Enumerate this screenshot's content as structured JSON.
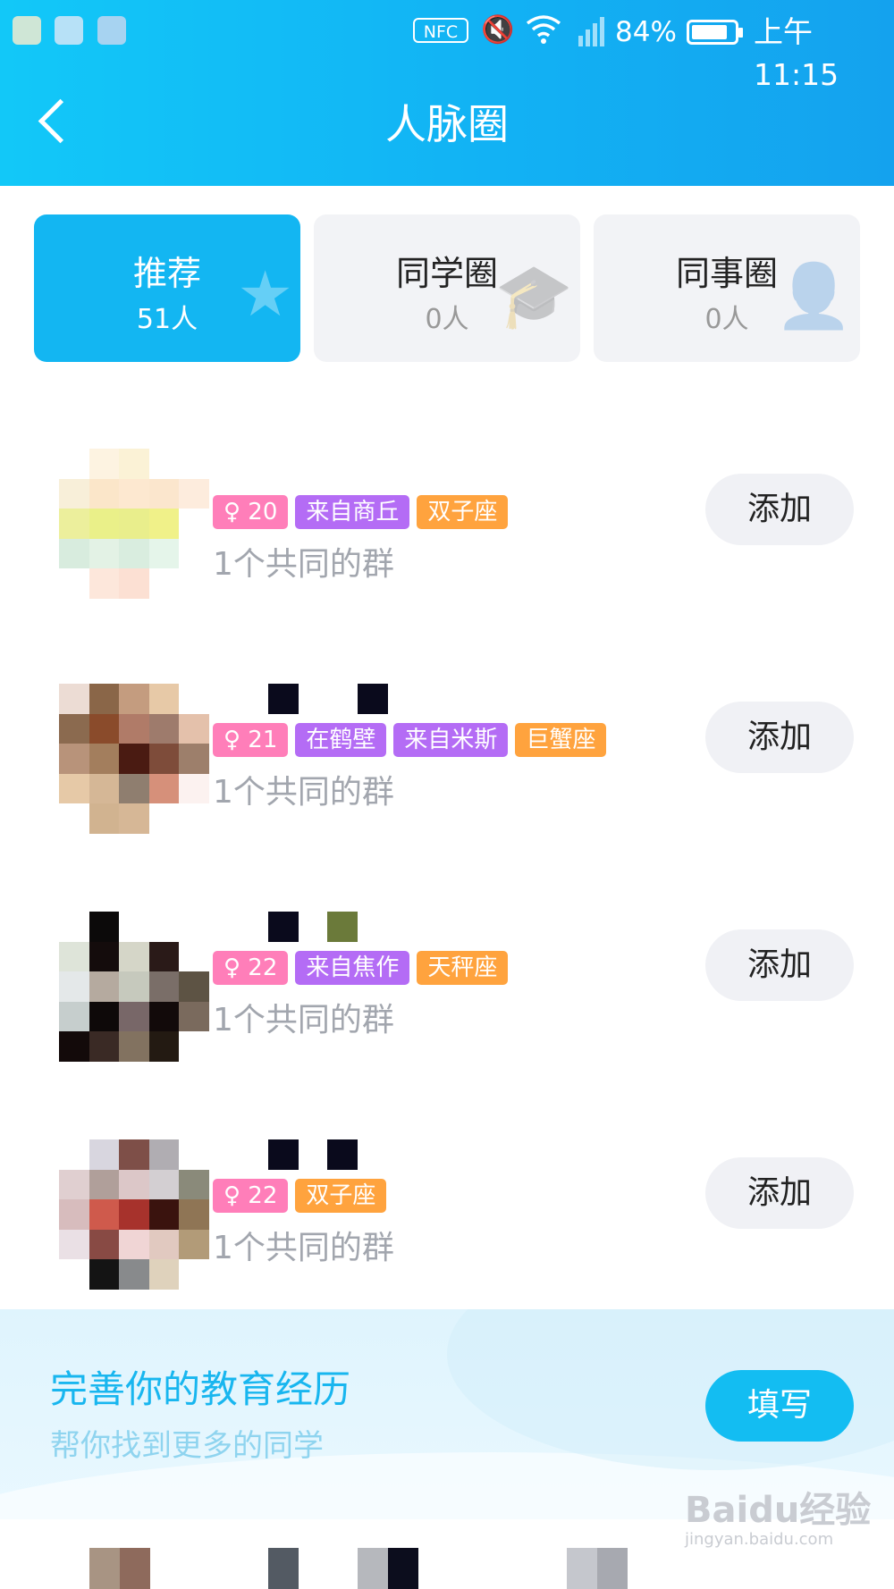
{
  "status_bar": {
    "nfc": "NFC",
    "battery_percent": "84%",
    "battery_level": 0.84,
    "time": "上午11:15",
    "icons": [
      "shield-app-icon",
      "wechat-icon",
      "gallery-icon",
      "mute-icon",
      "wifi-icon",
      "signal-icon"
    ]
  },
  "header": {
    "title": "人脉圈",
    "back_icon": "chevron-left-icon",
    "color": "#12b2f4"
  },
  "tabs": [
    {
      "label": "推荐",
      "count": "51人",
      "active": true,
      "icon": "star-card-icon"
    },
    {
      "label": "同学圈",
      "count": "0人",
      "active": false,
      "icon": "graduate-icon"
    },
    {
      "label": "同事圈",
      "count": "0人",
      "active": false,
      "icon": "worker-icon"
    }
  ],
  "people": [
    {
      "tags": [
        {
          "text": "♀ 20",
          "color": "pink"
        },
        {
          "text": "来自商丘",
          "color": "purple"
        },
        {
          "text": "双子座",
          "color": "orange"
        }
      ],
      "common_groups": "1个共同的群",
      "add_label": "添加"
    },
    {
      "tags": [
        {
          "text": "♀ 21",
          "color": "pink"
        },
        {
          "text": "在鹤壁",
          "color": "purple"
        },
        {
          "text": "来自米斯",
          "color": "purple"
        },
        {
          "text": "巨蟹座",
          "color": "orange"
        }
      ],
      "common_groups": "1个共同的群",
      "add_label": "添加"
    },
    {
      "tags": [
        {
          "text": "♀ 22",
          "color": "pink"
        },
        {
          "text": "来自焦作",
          "color": "purple"
        },
        {
          "text": "天秤座",
          "color": "orange"
        }
      ],
      "common_groups": "1个共同的群",
      "add_label": "添加"
    },
    {
      "tags": [
        {
          "text": "♀ 22",
          "color": "pink"
        },
        {
          "text": "双子座",
          "color": "orange"
        }
      ],
      "common_groups": "1个共同的群",
      "add_label": "添加"
    }
  ],
  "edu_banner": {
    "title": "完善你的教育经历",
    "subtitle": "帮你找到更多的同学",
    "button": "填写"
  },
  "watermark": {
    "logo": "Baidu经验",
    "url": "jingyan.baidu.com"
  },
  "colors": {
    "accent": "#13b6f2",
    "tag_pink": "#ff7eb9",
    "tag_purple": "#b46cf5",
    "tag_orange": "#ffa33e"
  }
}
